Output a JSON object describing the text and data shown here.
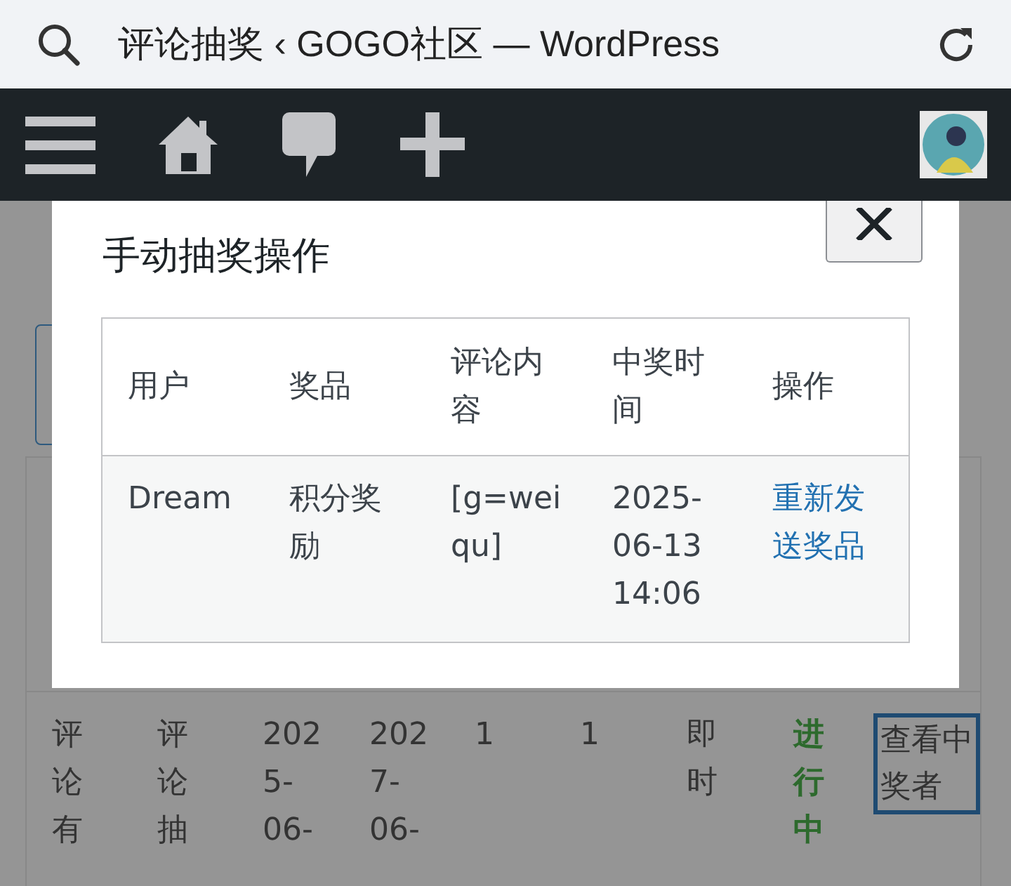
{
  "browser": {
    "title": "评论抽奖 ‹ GOGO社区 — WordPress"
  },
  "page": {
    "row": {
      "cells": [
        "评论有",
        "评论抽",
        "2025-06-",
        "2027-06-",
        "1",
        "1",
        "即时"
      ],
      "status": "进行中",
      "action": "查看中奖者"
    }
  },
  "modal": {
    "title": "手动抽奖操作",
    "columns": [
      "用户",
      "奖品",
      "评论内容",
      "中奖时间",
      "操作"
    ],
    "rows": [
      {
        "cells": [
          "Dream",
          "积分奖励",
          "[g=weiqu]",
          "2025-06-13 14:06"
        ],
        "action": "重新发送奖品"
      }
    ]
  }
}
